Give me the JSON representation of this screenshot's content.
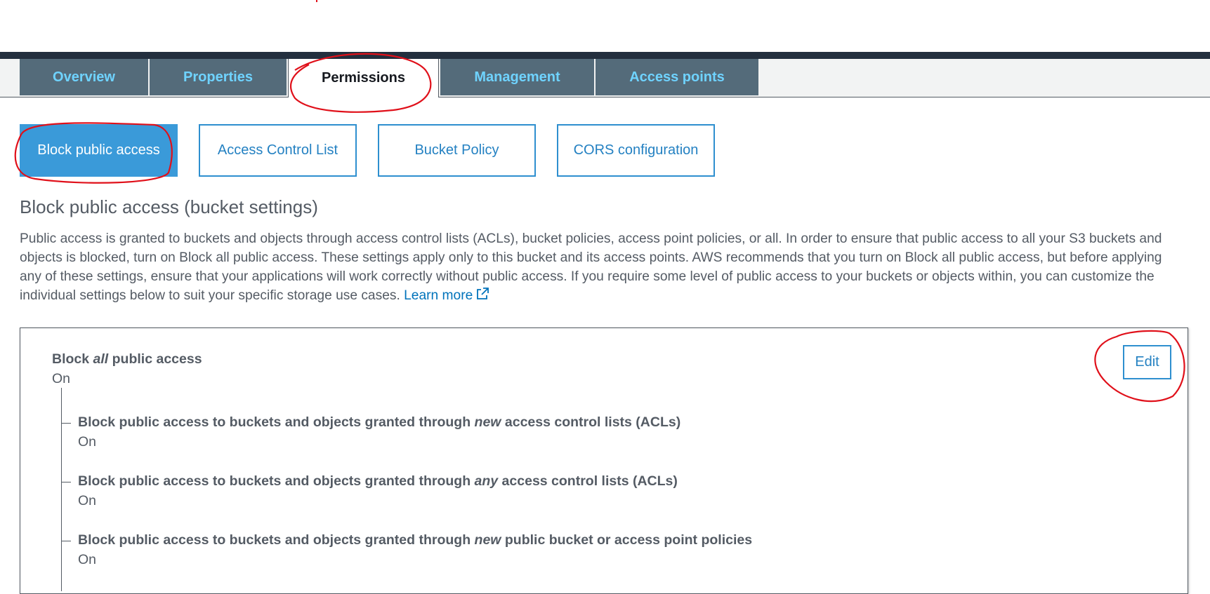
{
  "tabs": [
    {
      "label": "Overview",
      "active": false
    },
    {
      "label": "Properties",
      "active": false
    },
    {
      "label": "Permissions",
      "active": true
    },
    {
      "label": "Management",
      "active": false
    },
    {
      "label": "Access points",
      "active": false
    }
  ],
  "subtabs": [
    {
      "label": "Block public access",
      "active": true
    },
    {
      "label": "Access Control List",
      "active": false
    },
    {
      "label": "Bucket Policy",
      "active": false
    },
    {
      "label": "CORS configuration",
      "active": false
    }
  ],
  "section": {
    "title": "Block public access (bucket settings)",
    "description": "Public access is granted to buckets and objects through access control lists (ACLs), bucket policies, access point policies, or all. In order to ensure that public access to all your S3 buckets and objects is blocked, turn on Block all public access. These settings apply only to this bucket and its access points. AWS recommends that you turn on Block all public access, but before applying any of these settings, ensure that your applications will work correctly without public access. If you require some level of public access to your buckets or objects within, you can customize the individual settings below to suit your specific storage use cases.",
    "learn_more": "Learn more"
  },
  "settings": {
    "main": {
      "label_pre": "Block ",
      "label_em": "all",
      "label_post": " public access",
      "status": "On"
    },
    "items": [
      {
        "pre": "Block public access to buckets and objects granted through ",
        "em": "new",
        "post": " access control lists (ACLs)",
        "status": "On"
      },
      {
        "pre": "Block public access to buckets and objects granted through ",
        "em": "any",
        "post": " access control lists (ACLs)",
        "status": "On"
      },
      {
        "pre": "Block public access to buckets and objects granted through ",
        "em": "new",
        "post": " public bucket or access point policies",
        "status": "On"
      }
    ],
    "edit_label": "Edit"
  },
  "colors": {
    "tab_bg": "#546b7a",
    "tab_text": "#6fd3ff",
    "accent": "#2e8fcf",
    "annotation": "#e0101a"
  }
}
